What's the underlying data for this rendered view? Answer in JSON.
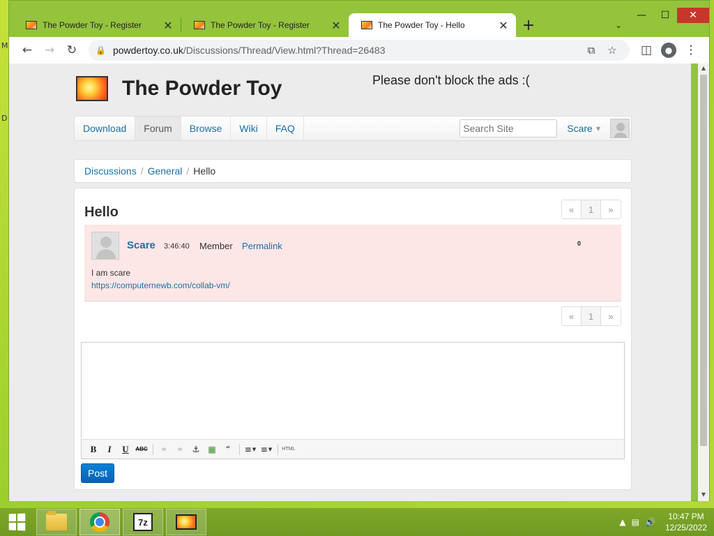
{
  "desktop": {
    "edge_glyphs": [
      "M",
      "D"
    ]
  },
  "browser": {
    "tabs": [
      {
        "title": "The Powder Toy - Register",
        "active": false
      },
      {
        "title": "The Powder Toy - Register",
        "active": false
      },
      {
        "title": "The Powder Toy - Hello",
        "active": true
      }
    ],
    "url_host": "powdertoy.co.uk",
    "url_path": "/Discussions/Thread/View.html?Thread=26483"
  },
  "site": {
    "title": "The Powder Toy",
    "ads_text": "Please don't block the ads :(",
    "nav": [
      {
        "label": "Download",
        "active": false
      },
      {
        "label": "Forum",
        "active": true
      },
      {
        "label": "Browse",
        "active": false
      },
      {
        "label": "Wiki",
        "active": false
      },
      {
        "label": "FAQ",
        "active": false
      }
    ],
    "search_placeholder": "Search Site",
    "user": "Scare"
  },
  "breadcrumb": {
    "items": [
      "Discussions",
      "General"
    ],
    "current": "Hello"
  },
  "thread": {
    "title": "Hello",
    "pager": {
      "prev": "«",
      "page": "1",
      "next": "»"
    },
    "post": {
      "author": "Scare",
      "time": "3:46:40",
      "rank": "Member",
      "permalink": "Permalink",
      "score": "0",
      "body_text": "I am scare",
      "body_link": "https://computernewb.com/collab-vm/"
    },
    "post_button": "Post"
  },
  "taskbar": {
    "zip_label": "7z",
    "time": "10:47 PM",
    "date": "12/25/2022"
  }
}
